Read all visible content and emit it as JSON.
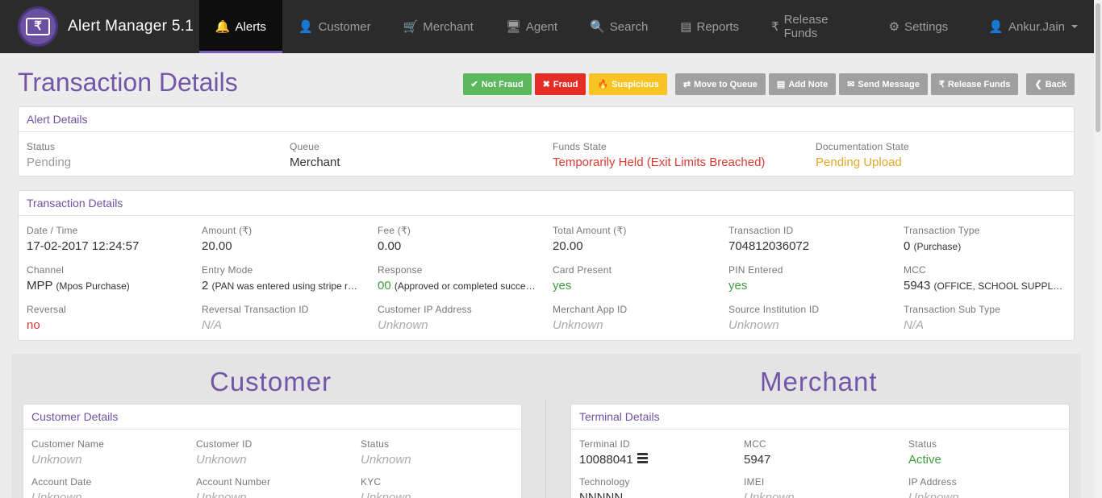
{
  "navbar": {
    "brand": "Alert Manager 5.1",
    "brand_logo_symbol": "₹",
    "items": [
      {
        "label": "Alerts",
        "icon": "bell-icon",
        "glyph": "🔔",
        "active": true
      },
      {
        "label": "Customer",
        "icon": "user-icon",
        "glyph": "👤"
      },
      {
        "label": "Merchant",
        "icon": "cart-icon",
        "glyph": "🛒"
      },
      {
        "label": "Agent",
        "icon": "monitor-icon",
        "glyph": "🖥"
      },
      {
        "label": "Search",
        "icon": "search-icon",
        "glyph": "🔍"
      },
      {
        "label": "Reports",
        "icon": "list-icon",
        "glyph": "▤"
      },
      {
        "label": "Release Funds",
        "icon": "rupee-icon",
        "glyph": "₹"
      },
      {
        "label": "Settings",
        "icon": "gear-icon",
        "glyph": "⚙"
      }
    ],
    "user": {
      "label": "Ankur.Jain",
      "icon": "user-icon",
      "glyph": "👤"
    }
  },
  "page": {
    "title": "Transaction Details",
    "actions": [
      {
        "label": "Not Fraud",
        "glyph": "✔",
        "icon": "check-icon",
        "color": "#5cb85c"
      },
      {
        "label": "Fraud",
        "glyph": "✖",
        "icon": "times-icon",
        "color": "#e52d27"
      },
      {
        "label": "Suspicious",
        "glyph": "🔥",
        "icon": "fire-icon",
        "color": "#f7c325"
      },
      {
        "label": "Move to Queue",
        "glyph": "⇄",
        "icon": "exchange-icon",
        "color": "#a0a0a0"
      },
      {
        "label": "Add Note",
        "glyph": "▤",
        "icon": "note-icon",
        "color": "#a0a0a0"
      },
      {
        "label": "Send Message",
        "glyph": "✉",
        "icon": "envelope-icon",
        "color": "#a0a0a0"
      },
      {
        "label": "Release Funds",
        "glyph": "₹",
        "icon": "rupee-icon",
        "color": "#a0a0a0"
      },
      {
        "label": "Back",
        "glyph": "❮",
        "icon": "chevron-left-icon",
        "color": "#a0a0a0"
      }
    ]
  },
  "alert_details": {
    "heading": "Alert Details",
    "status": {
      "label": "Status",
      "value": "Pending"
    },
    "queue": {
      "label": "Queue",
      "value": "Merchant"
    },
    "funds_state": {
      "label": "Funds State",
      "value": "Temporarily Held (Exit Limits Breached)"
    },
    "documentation_state": {
      "label": "Documentation State",
      "value": "Pending Upload"
    }
  },
  "transaction_details": {
    "heading": "Transaction Details",
    "date_time": {
      "label": "Date / Time",
      "value": "17-02-2017 12:24:57"
    },
    "amount": {
      "label": "Amount (₹)",
      "value": "20.00"
    },
    "fee": {
      "label": "Fee (₹)",
      "value": "0.00"
    },
    "total_amount": {
      "label": "Total Amount (₹)",
      "value": "20.00"
    },
    "transaction_id": {
      "label": "Transaction ID",
      "value": "704812036072"
    },
    "transaction_type": {
      "label": "Transaction Type",
      "code": "0",
      "desc": "(Purchase)"
    },
    "channel": {
      "label": "Channel",
      "code": "MPP",
      "desc": "(Mpos Purchase)"
    },
    "entry_mode": {
      "label": "Entry Mode",
      "code": "2",
      "desc": "(PAN was entered using stripe r…"
    },
    "response": {
      "label": "Response",
      "code": "00",
      "desc": "(Approved or completed succe…"
    },
    "card_present": {
      "label": "Card Present",
      "value": "yes"
    },
    "pin_entered": {
      "label": "PIN Entered",
      "value": "yes"
    },
    "mcc": {
      "label": "MCC",
      "code": "5943",
      "desc": "(OFFICE, SCHOOL SUPPL…"
    },
    "reversal": {
      "label": "Reversal",
      "value": "no"
    },
    "reversal_transaction_id": {
      "label": "Reversal Transaction ID",
      "value": "N/A"
    },
    "customer_ip": {
      "label": "Customer IP Address",
      "value": "Unknown"
    },
    "merchant_app_id": {
      "label": "Merchant App ID",
      "value": "Unknown"
    },
    "source_institution_id": {
      "label": "Source Institution ID",
      "value": "Unknown"
    },
    "transaction_sub_type": {
      "label": "Transaction Sub Type",
      "value": "N/A"
    }
  },
  "customer": {
    "title": "Customer",
    "heading": "Customer Details",
    "name": {
      "label": "Customer Name",
      "value": "Unknown"
    },
    "id": {
      "label": "Customer ID",
      "value": "Unknown"
    },
    "status": {
      "label": "Status",
      "value": "Unknown"
    },
    "account_date": {
      "label": "Account Date",
      "value": "Unknown"
    },
    "account_number": {
      "label": "Account Number",
      "value": "Unknown"
    },
    "kyc": {
      "label": "KYC",
      "value": "Unknown"
    }
  },
  "merchant": {
    "title": "Merchant",
    "heading": "Terminal Details",
    "terminal_id": {
      "label": "Terminal ID",
      "value": "10088041"
    },
    "mcc": {
      "label": "MCC",
      "value": "5947"
    },
    "status": {
      "label": "Status",
      "value": "Active"
    },
    "technology": {
      "label": "Technology",
      "value": "NNNNN"
    },
    "imei": {
      "label": "IMEI",
      "value": "Unknown"
    },
    "ip_address": {
      "label": "IP Address",
      "value": "Unknown"
    }
  }
}
